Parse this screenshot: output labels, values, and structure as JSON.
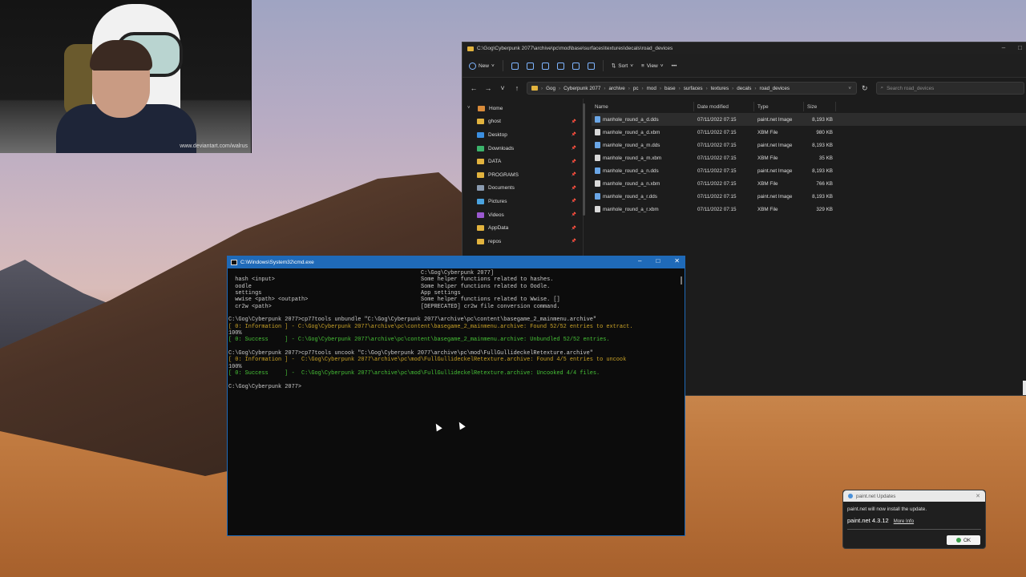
{
  "webcam": {
    "watermark": "www.deviantart.com/walrus"
  },
  "explorer": {
    "title": "C:\\Gog\\Cyberpunk 2077\\archive\\pc\\mod\\base\\surfaces\\textures\\decals\\road_devices",
    "toolbar": {
      "new_label": "New",
      "sort_label": "Sort",
      "view_label": "View",
      "more_label": "•••"
    },
    "breadcrumbs": [
      "Gog",
      "Cyberpunk 2077",
      "archive",
      "pc",
      "mod",
      "base",
      "surfaces",
      "textures",
      "decals",
      "road_devices"
    ],
    "search_placeholder": "Search road_devices",
    "nav": [
      {
        "label": "Home",
        "icon": "home-icon"
      },
      {
        "label": "ghost",
        "icon": "folder-icon"
      },
      {
        "label": "Desktop",
        "icon": "desktop-icon"
      },
      {
        "label": "Downloads",
        "icon": "download-icon"
      },
      {
        "label": "DATA",
        "icon": "folder-icon"
      },
      {
        "label": "PROGRAMS",
        "icon": "folder-icon"
      },
      {
        "label": "Documents",
        "icon": "documents-icon"
      },
      {
        "label": "Pictures",
        "icon": "pictures-icon"
      },
      {
        "label": "Videos",
        "icon": "videos-icon"
      },
      {
        "label": "AppData",
        "icon": "folder-icon"
      },
      {
        "label": "repos",
        "icon": "folder-icon"
      }
    ],
    "columns": {
      "name": "Name",
      "date": "Date modified",
      "type": "Type",
      "size": "Size"
    },
    "files": [
      {
        "name": "manhole_round_a_d.dds",
        "date": "07/11/2022 07:15",
        "type": "paint.net Image",
        "size": "8,193 KB"
      },
      {
        "name": "manhole_round_a_d.xbm",
        "date": "07/11/2022 07:15",
        "type": "XBM File",
        "size": "980 KB"
      },
      {
        "name": "manhole_round_a_m.dds",
        "date": "07/11/2022 07:15",
        "type": "paint.net Image",
        "size": "8,193 KB"
      },
      {
        "name": "manhole_round_a_m.xbm",
        "date": "07/11/2022 07:15",
        "type": "XBM File",
        "size": "35 KB"
      },
      {
        "name": "manhole_round_a_n.dds",
        "date": "07/11/2022 07:15",
        "type": "paint.net Image",
        "size": "8,193 KB"
      },
      {
        "name": "manhole_round_a_n.xbm",
        "date": "07/11/2022 07:15",
        "type": "XBM File",
        "size": "766 KB"
      },
      {
        "name": "manhole_round_a_r.dds",
        "date": "07/11/2022 07:15",
        "type": "paint.net Image",
        "size": "8,193 KB"
      },
      {
        "name": "manhole_round_a_r.xbm",
        "date": "07/11/2022 07:15",
        "type": "XBM File",
        "size": "329 KB"
      }
    ]
  },
  "cmd": {
    "title": "C:\\Windows\\System32\\cmd.exe",
    "lines": [
      {
        "left": "",
        "right": "C:\\Gog\\Cyberpunk 2077]",
        "cls": ""
      },
      {
        "left": "  hash <input>",
        "right": "Some helper functions related to hashes.",
        "cls": ""
      },
      {
        "left": "  oodle",
        "right": "Some helper functions related to Oodle.",
        "cls": ""
      },
      {
        "left": "  settings",
        "right": "App settings",
        "cls": ""
      },
      {
        "left": "  wwise <path> <outpath>",
        "right": "Some helper functions related to Wwise. []",
        "cls": ""
      },
      {
        "left": "  cr2w <path>",
        "right": "[DEPRECATED] cr2w file conversion command.",
        "cls": ""
      },
      {
        "left": "",
        "right": "",
        "cls": ""
      },
      {
        "full": "C:\\Gog\\Cyberpunk 2077>cp77tools unbundle \"C:\\Gog\\Cyberpunk 2077\\archive\\pc\\content\\basegame_2_mainmenu.archive\"",
        "cls": ""
      },
      {
        "full": "[ 0: Information ] - C:\\Gog\\Cyberpunk 2077\\archive\\pc\\content\\basegame_2_mainmenu.archive: Found 52/52 entries to extract.",
        "cls": "c-info"
      },
      {
        "full": "100%",
        "cls": ""
      },
      {
        "full": "[ 0: Success     ] - C:\\Gog\\Cyberpunk 2077\\archive\\pc\\content\\basegame_2_mainmenu.archive: Unbundled 52/52 entries.",
        "cls": "c-succ"
      },
      {
        "full": "",
        "cls": ""
      },
      {
        "full": "C:\\Gog\\Cyberpunk 2077>cp77tools uncook \"C:\\Gog\\Cyberpunk 2077\\archive\\pc\\mod\\FullGullideckelRetexture.archive\"",
        "cls": ""
      },
      {
        "full": "[ 0: Information ] -  C:\\Gog\\Cyberpunk 2077\\archive\\pc\\mod\\FullGullideckelRetexture.archive: Found 4/5 entries to uncook",
        "cls": "c-info"
      },
      {
        "full": "100%",
        "cls": ""
      },
      {
        "full": "[ 0: Success     ] -  C:\\Gog\\Cyberpunk 2077\\archive\\pc\\mod\\FullGullideckelRetexture.archive: Uncooked 4/4 files.",
        "cls": "c-succ"
      },
      {
        "full": "",
        "cls": ""
      },
      {
        "full": "C:\\Gog\\Cyberpunk 2077>",
        "cls": ""
      }
    ]
  },
  "notification": {
    "app": "paint.net Updates",
    "message": "paint.net will now install the update.",
    "version": "paint.net 4.3.12",
    "more_info": "More Info",
    "ok": "OK"
  }
}
